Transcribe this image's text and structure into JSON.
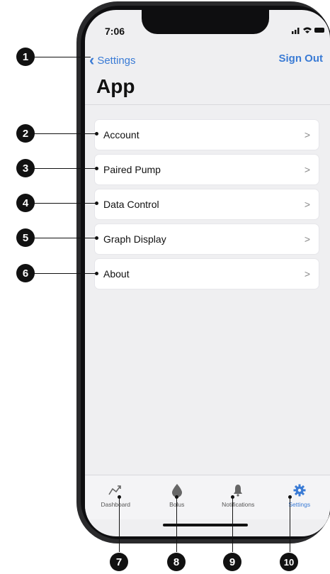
{
  "status": {
    "time": "7:06",
    "icons": "signal wifi battery"
  },
  "nav": {
    "back_label": "Settings",
    "sign_out": "Sign Out"
  },
  "title": "App",
  "menu": [
    {
      "label": "Account"
    },
    {
      "label": "Paired Pump"
    },
    {
      "label": "Data Control"
    },
    {
      "label": "Graph Display"
    },
    {
      "label": "About"
    }
  ],
  "chevron": ">",
  "tabs": [
    {
      "label": "Dashboard",
      "icon": "trend-icon"
    },
    {
      "label": "Bolus",
      "icon": "drop-icon"
    },
    {
      "label": "Notifications",
      "icon": "bell-icon"
    },
    {
      "label": "Settings",
      "icon": "gear-icon",
      "active": true
    }
  ],
  "callouts": [
    "1",
    "2",
    "3",
    "4",
    "5",
    "6",
    "7",
    "8",
    "9",
    "10"
  ],
  "colors": {
    "accent": "#3a7bd5",
    "callout": "#111111"
  }
}
